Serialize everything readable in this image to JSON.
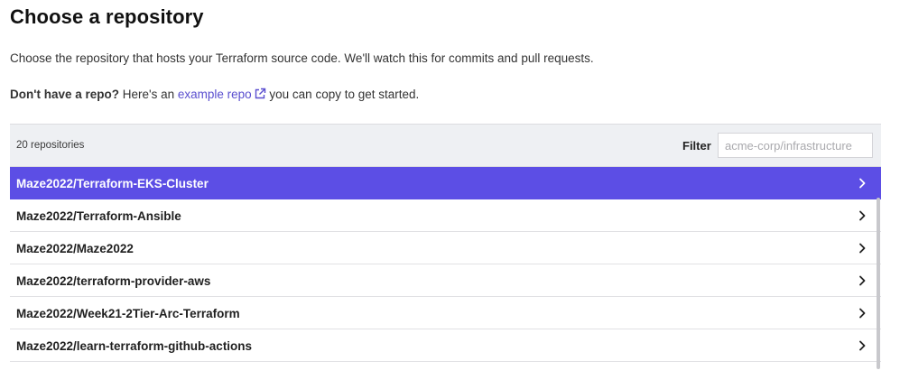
{
  "header": {
    "title": "Choose a repository",
    "description": "Choose the repository that hosts your Terraform source code. We'll watch this for commits and pull requests.",
    "example_prefix_bold": "Don't have a repo?",
    "example_prefix": " Here's an ",
    "example_link": "example repo",
    "example_suffix": " you can copy to get started."
  },
  "panel": {
    "repo_count": "20 repositories",
    "filter_label": "Filter",
    "filter_placeholder": "acme-corp/infrastructure",
    "filter_value": ""
  },
  "repos": [
    {
      "name": "Maze2022/Terraform-EKS-Cluster",
      "selected": true
    },
    {
      "name": "Maze2022/Terraform-Ansible",
      "selected": false
    },
    {
      "name": "Maze2022/Maze2022",
      "selected": false
    },
    {
      "name": "Maze2022/terraform-provider-aws",
      "selected": false
    },
    {
      "name": "Maze2022/Week21-2Tier-Arc-Terraform",
      "selected": false
    },
    {
      "name": "Maze2022/learn-terraform-github-actions",
      "selected": false
    }
  ],
  "colors": {
    "accent": "#5c4ee5",
    "link": "#5a4fcf",
    "header_bg": "#eef0f3"
  },
  "icons": {
    "external_link": "external-link-icon",
    "row_chevron": "chevron-right-icon"
  }
}
